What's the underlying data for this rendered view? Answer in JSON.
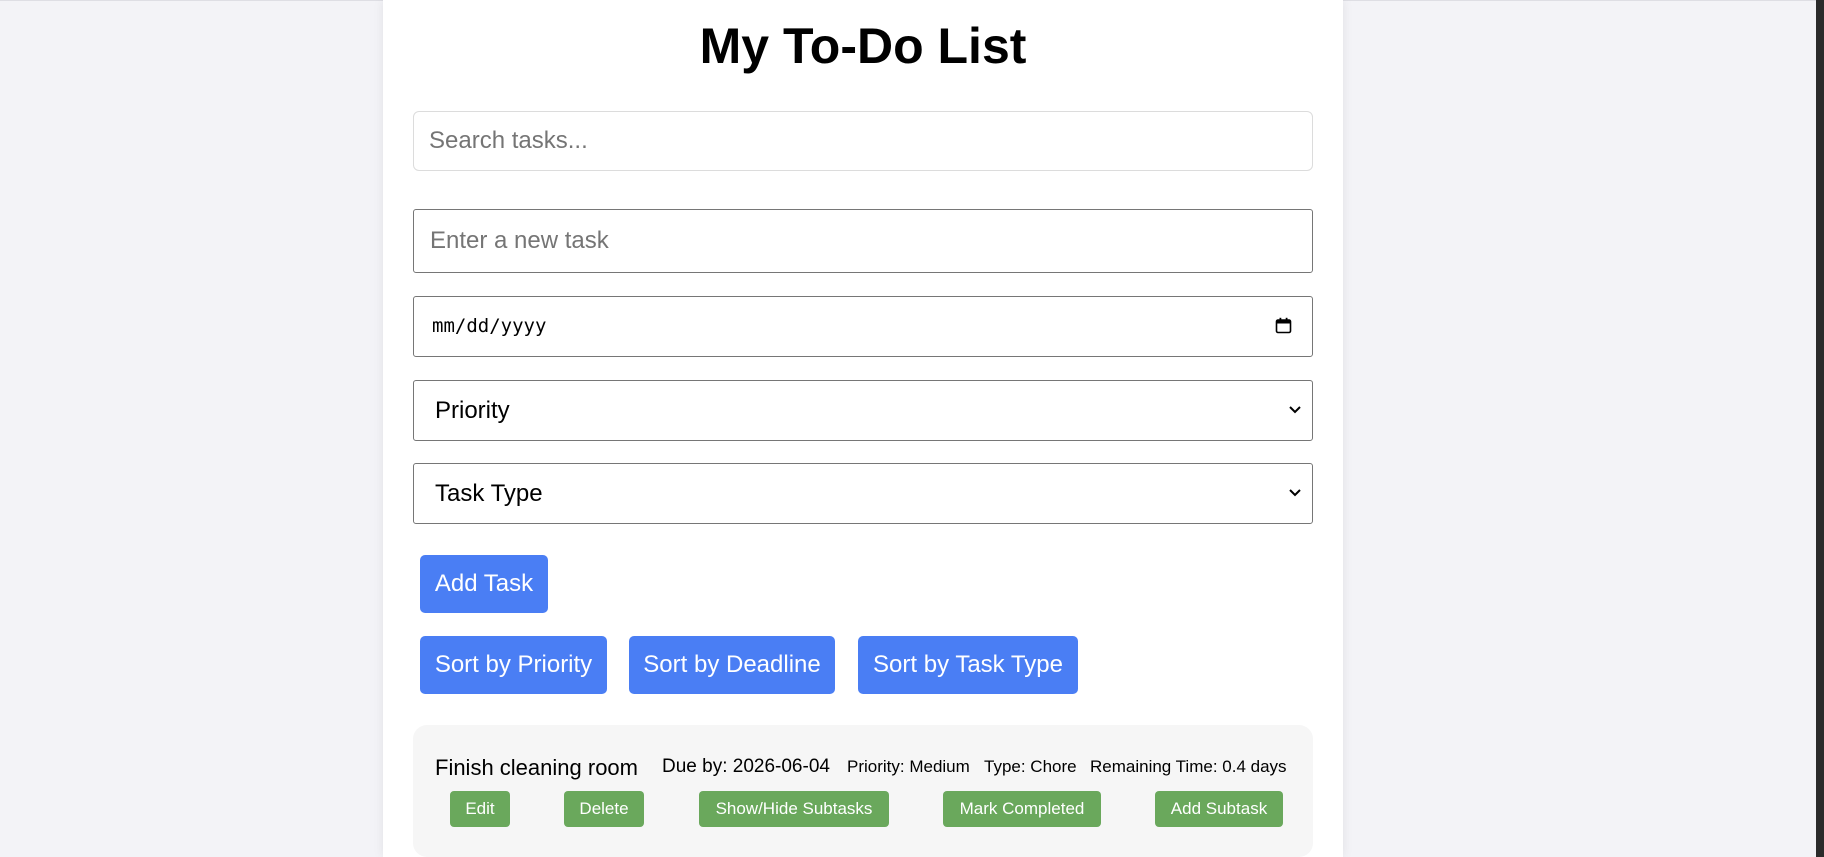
{
  "page": {
    "title": "My To-Do List"
  },
  "form": {
    "search_placeholder": "Search tasks...",
    "task_placeholder": "Enter a new task",
    "date_placeholder": "mm/dd/yyyy",
    "priority_selected": "Priority",
    "type_selected": "Task Type",
    "add_label": "Add Task"
  },
  "sort": {
    "priority_label": "Sort by Priority",
    "deadline_label": "Sort by Deadline",
    "type_label": "Sort by Task Type"
  },
  "tasks": [
    {
      "name": "Finish cleaning room",
      "due": "Due by: 2026-06-04",
      "priority": "Priority: Medium",
      "type": "Type: Chore",
      "remaining": "Remaining Time: 0.4 days",
      "actions": {
        "edit": "Edit",
        "delete": "Delete",
        "toggle_subtasks": "Show/Hide Subtasks",
        "complete": "Mark Completed",
        "add_subtask": "Add Subtask"
      }
    }
  ],
  "colors": {
    "primary_button": "#4a7ef4",
    "task_button": "#6aa85c",
    "task_background": "#f6f6f6",
    "page_background": "#f3f3f7"
  },
  "icons": {
    "date": "calendar-icon",
    "select": "chevron-down-icon"
  }
}
